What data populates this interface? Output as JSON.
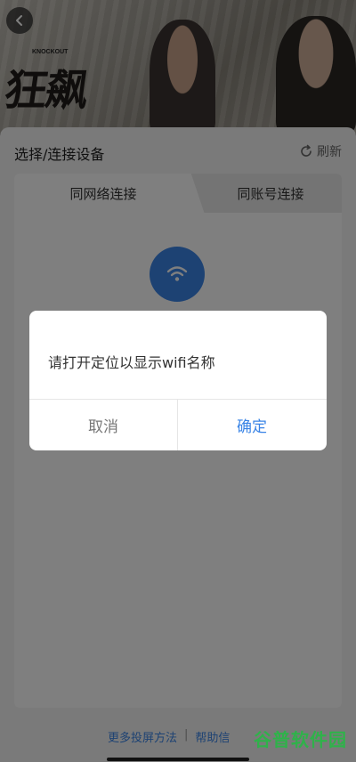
{
  "banner": {
    "title_art": "狂飙",
    "title_sub": "KNOCKOUT"
  },
  "header": {
    "title": "选择/连接设备",
    "refresh_label": "刷新"
  },
  "tabs": [
    {
      "label": "同网络连接",
      "active": true
    },
    {
      "label": "同账号连接",
      "active": false
    }
  ],
  "icons": {
    "back": "back-arrow-icon",
    "refresh": "refresh-icon",
    "wifi": "wifi-icon"
  },
  "footer": {
    "more_methods": "更多投屏方法",
    "separator": "|",
    "help": "帮助信"
  },
  "dialog": {
    "message": "请打开定位以显示wifi名称",
    "cancel_label": "取消",
    "confirm_label": "确定"
  },
  "watermark": {
    "text": "谷普软件园"
  },
  "colors": {
    "accent": "#3a84e6",
    "panel_bg": "#f5f5f5",
    "overlay": "rgba(0,0,0,0.5)",
    "watermark": "#2fb24a"
  }
}
